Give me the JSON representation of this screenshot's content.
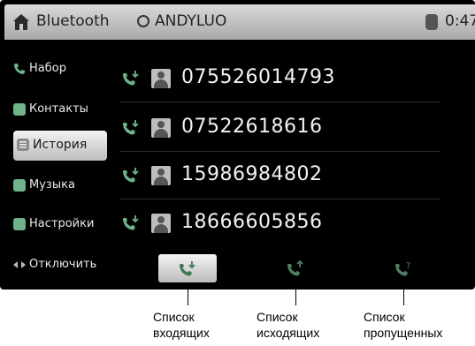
{
  "statusbar": {
    "title": "Bluetooth",
    "device_name": "ANDYLUO",
    "time": "0:47"
  },
  "sidebar": {
    "items": [
      {
        "label": "Набор",
        "icon": "phone-icon",
        "active": false
      },
      {
        "label": "Контакты",
        "icon": "contacts-icon",
        "active": false
      },
      {
        "label": "История",
        "icon": "history-icon",
        "active": true
      },
      {
        "label": "Музыка",
        "icon": "music-icon",
        "active": false
      },
      {
        "label": "Настройки",
        "icon": "settings-icon",
        "active": false
      },
      {
        "label": "Отключить",
        "icon": "disconnect-icon",
        "active": false
      }
    ]
  },
  "call_list": [
    {
      "number": "075526014793"
    },
    {
      "number": "07522618616"
    },
    {
      "number": "15986984802"
    },
    {
      "number": "18666605856"
    }
  ],
  "tabs": [
    {
      "icon": "incoming-call-icon",
      "active": true
    },
    {
      "icon": "outgoing-call-icon",
      "active": false
    },
    {
      "icon": "missed-call-icon",
      "active": false
    }
  ],
  "captions": {
    "incoming": [
      "Список",
      "входящих"
    ],
    "outgoing": [
      "Список",
      "исходящих"
    ],
    "missed": [
      "Список",
      "пропущенных"
    ]
  },
  "colors": {
    "accent_green": "#6fb38a",
    "statusbar_bg": "#c4c4c4",
    "background": "#000000"
  }
}
